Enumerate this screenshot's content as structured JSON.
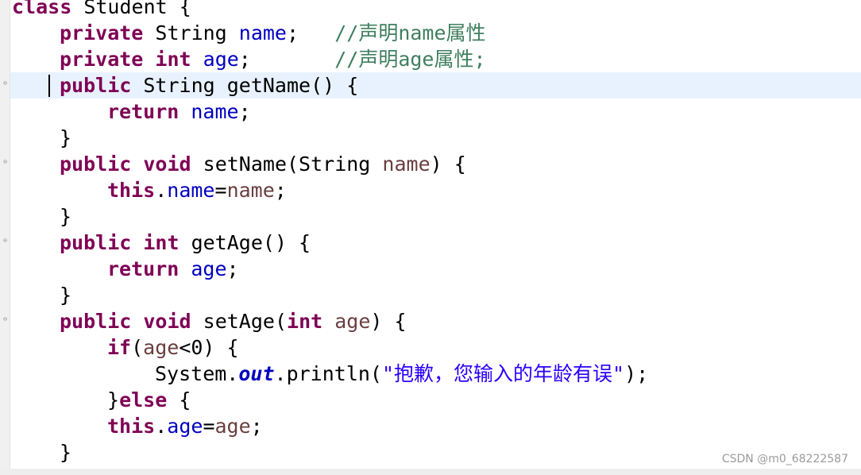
{
  "code": {
    "line1": {
      "kw": "class",
      "rest": " Student {"
    },
    "line2": {
      "kw": "private",
      "type": " String ",
      "field": "name",
      "semi": ";   ",
      "comment": "//声明name属性"
    },
    "line3": {
      "kw1": "private",
      "sp": " ",
      "kw2": "int",
      "sp2": " ",
      "field": "age",
      "semi": ";       ",
      "comment": "//声明age属性;"
    },
    "line4": {
      "kw": "public",
      "rest": " String getName() {"
    },
    "line5": {
      "kw": "return",
      "sp": " ",
      "field": "name",
      "semi": ";"
    },
    "line6": {
      "brace": "}"
    },
    "line7": {
      "kw1": "public",
      "sp": " ",
      "kw2": "void",
      "mid": " setName(String ",
      "param": "name",
      "end": ") {"
    },
    "line8": {
      "kw": "this",
      "dot": ".",
      "field": "name",
      "eq": "=",
      "param": "name",
      "semi": ";"
    },
    "line9": {
      "brace": "}"
    },
    "line10": {
      "kw1": "public",
      "sp": " ",
      "kw2": "int",
      "rest": " getAge() {"
    },
    "line11": {
      "kw": "return",
      "sp": " ",
      "field": "age",
      "semi": ";"
    },
    "line12": {
      "brace": "}"
    },
    "line13": {
      "kw1": "public",
      "sp": " ",
      "kw2": "void",
      "mid": " setAge(",
      "kw3": "int",
      "sp2": " ",
      "param": "age",
      "end": ") {"
    },
    "line14": {
      "kw": "if",
      "open": "(",
      "param": "age",
      "rest": "<0) {"
    },
    "line15": {
      "sys": "System.",
      "out": "out",
      "call": ".println(",
      "str": "\"抱歉，您输入的年龄有误\"",
      "end": ");"
    },
    "line16": {
      "brace": "}",
      "kw": "else",
      "rest": " {"
    },
    "line17": {
      "kw": "this",
      "dot": ".",
      "field": "age",
      "eq": "=",
      "param": "age",
      "semi": ";"
    },
    "line18": {
      "brace": "}"
    }
  },
  "fold_marker": "⊖",
  "watermark": "CSDN @m0_68222587",
  "colors": {
    "keyword": "#7f0055",
    "field": "#0000c0",
    "parameter": "#6a3e3e",
    "string": "#2a00ff",
    "comment": "#3f7f5f",
    "current_line": "#e8f2fe"
  }
}
